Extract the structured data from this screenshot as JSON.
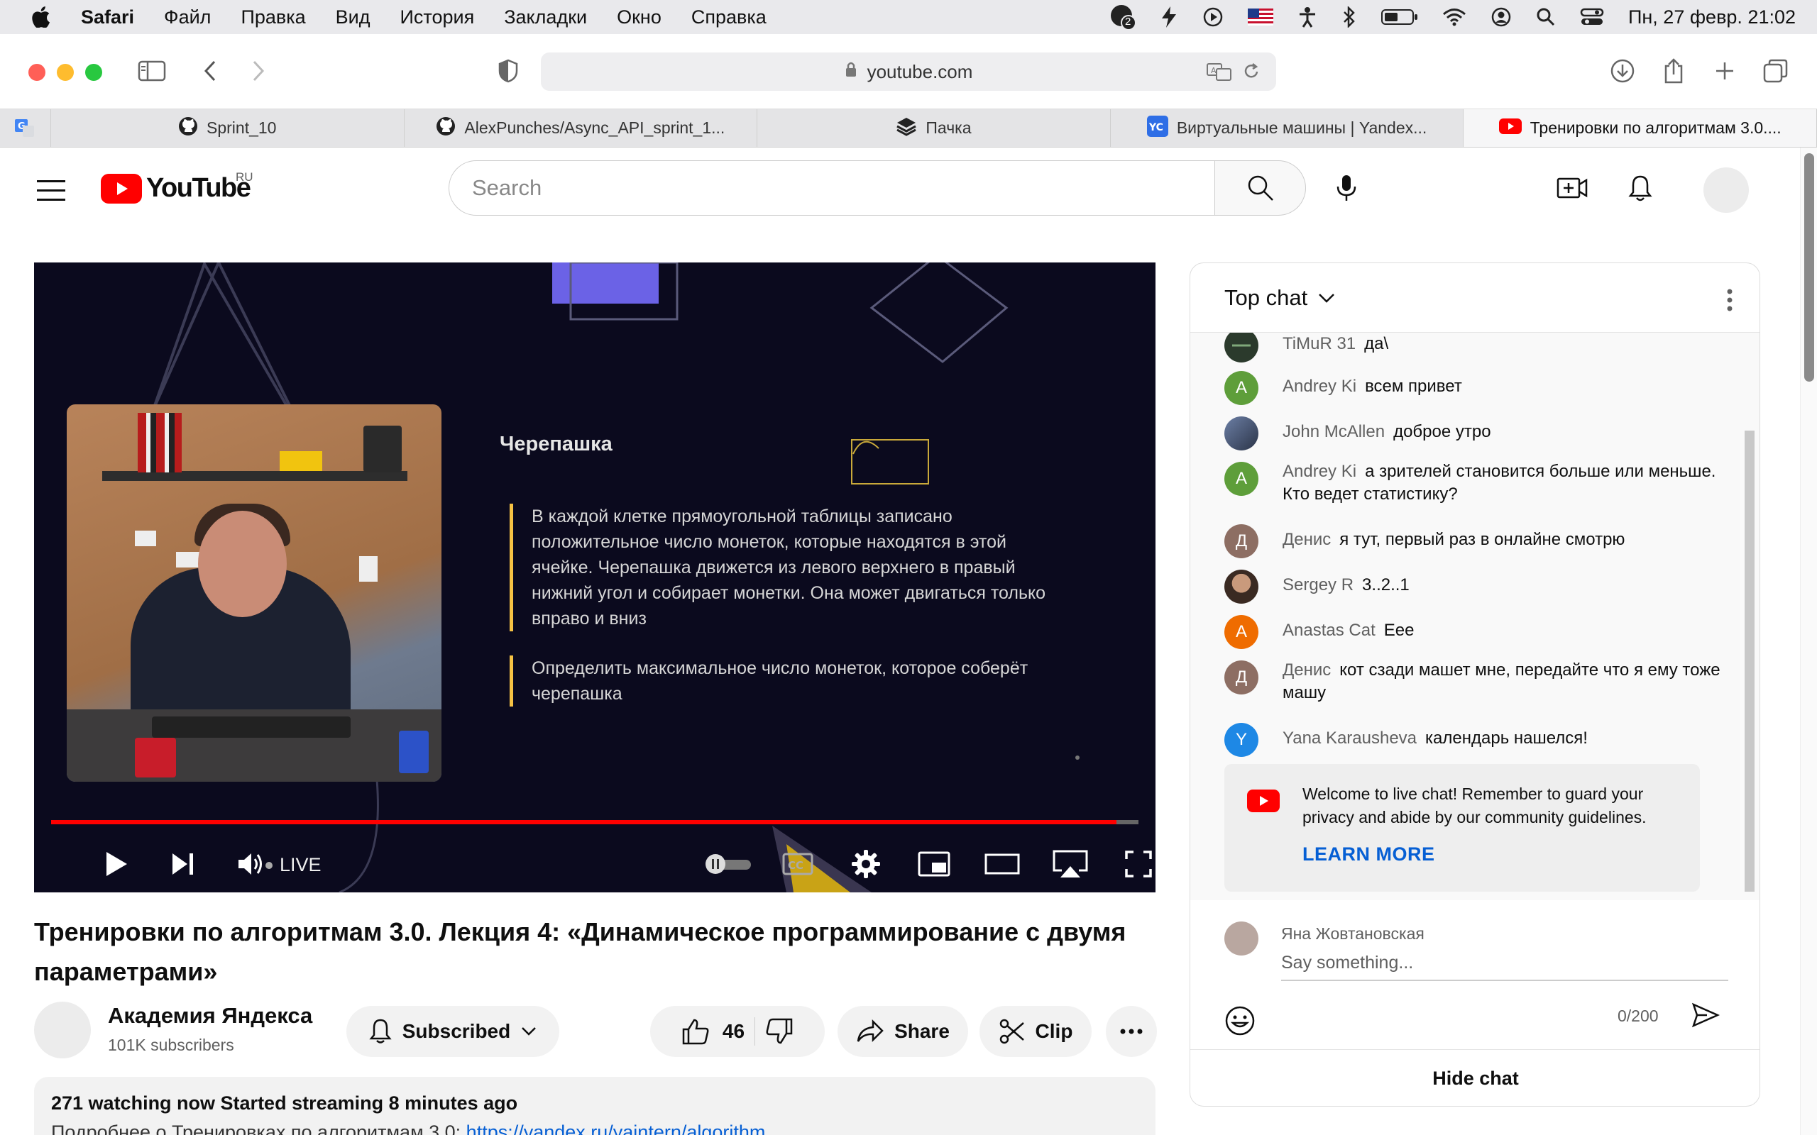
{
  "menubar": {
    "app": "Safari",
    "items": [
      "Файл",
      "Правка",
      "Вид",
      "История",
      "Закладки",
      "Окно",
      "Справка"
    ],
    "clock": "Пн, 27 февр.  21:02",
    "badge": "2"
  },
  "toolbar": {
    "url": "youtube.com"
  },
  "tabs": [
    {
      "label": "Sprint_10",
      "icon": "github-icon"
    },
    {
      "label": "AlexPunches/Async_API_sprint_1...",
      "icon": "github-icon"
    },
    {
      "label": "Пачка",
      "icon": "pachka-icon"
    },
    {
      "label": "Виртуальные машины | Yandex...",
      "icon": "yc-icon"
    },
    {
      "label": "Тренировки по алгоритмам 3.0....",
      "icon": "youtube-icon"
    }
  ],
  "youtube": {
    "logo_text": "YouTube",
    "region": "RU",
    "search_placeholder": "Search"
  },
  "player": {
    "slide_title": "Черепашка",
    "slide_para1": "В каждой клетке прямоугольной таблицы записано положительное число монеток, которые находятся в этой ячейке. Черепашка движется из левого верхнего в правый нижний угол и собирает монетки. Она может двигаться только вправо и вниз",
    "slide_para2": "Определить максимальное число монеток, которое соберёт черепашка",
    "live_label": "LIVE",
    "progress": 0.98,
    "accent": "#ff0000"
  },
  "video": {
    "title": "Тренировки по алгоритмам 3.0. Лекция 4: «Динамическое программирование с двумя параметрами»",
    "channel": "Академия Яндекса",
    "subscribers": "101K subscribers",
    "subscribed_label": "Subscribed",
    "likes": "46",
    "share_label": "Share",
    "clip_label": "Clip",
    "watching": "271 watching now  Started streaming 8 minutes ago",
    "desc_prefix": "Подробнее о Тренировках по алгоритмам 3.0: ",
    "desc_link": "https://yandex.ru/yaintern/algorithm"
  },
  "chat": {
    "header": "Top chat",
    "messages": [
      {
        "author": "TiMuR 31",
        "text": "да\\",
        "initial": "",
        "color": "#2b3a2c"
      },
      {
        "author": "Andrey Ki",
        "text": "всем привет",
        "initial": "A",
        "color": "#5e9e3a"
      },
      {
        "author": "John McAllen",
        "text": "доброе утро",
        "initial": "",
        "color": "#4a5a78"
      },
      {
        "author": "Andrey Ki",
        "text": "а зрителей становится больше или меньше. Кто ведет статистику?",
        "initial": "A",
        "color": "#5e9e3a"
      },
      {
        "author": "Денис",
        "text": "я тут, первый раз в онлайне смотрю",
        "initial": "Д",
        "color": "#8d6e63"
      },
      {
        "author": "Sergey R",
        "text": "3..2..1",
        "initial": "",
        "color": "#5a4a3c"
      },
      {
        "author": "Anastas Cat",
        "text": "Eee",
        "initial": "A",
        "color": "#ef6c00"
      },
      {
        "author": "Денис",
        "text": "кот сзади машет мне, передайте что я ему тоже машу",
        "initial": "Д",
        "color": "#8d6e63"
      },
      {
        "author": "Yana Karausheva",
        "text": "календарь нашелся!",
        "initial": "Y",
        "color": "#1e88e5"
      }
    ],
    "welcome_text": "Welcome to live chat! Remember to guard your privacy and abide by our community guidelines.",
    "learn_more": "LEARN MORE",
    "user_name": "Яна Жовтановская",
    "input_placeholder": "Say something...",
    "char_count": "0/200",
    "hide_chat": "Hide chat"
  }
}
